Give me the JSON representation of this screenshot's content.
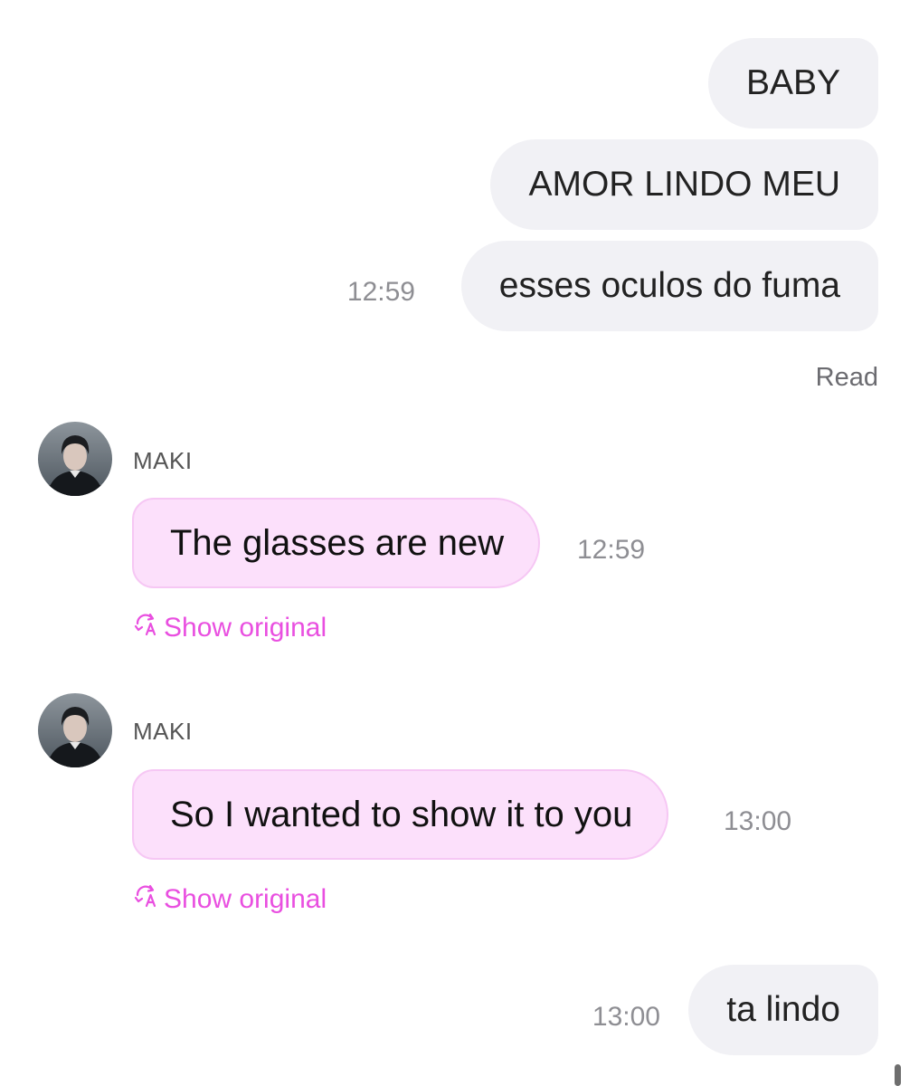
{
  "outgoing_group_1": {
    "messages": [
      {
        "text": "BABY"
      },
      {
        "text": "AMOR LINDO MEU"
      },
      {
        "text": "esses oculos do fuma"
      }
    ],
    "time": "12:59",
    "status": "Read"
  },
  "incoming": [
    {
      "sender": "MAKI",
      "text": "The glasses are new",
      "time": "12:59",
      "translate_action": "Show original"
    },
    {
      "sender": "MAKI",
      "text": "So I wanted to show it to you",
      "time": "13:00",
      "translate_action": "Show original"
    }
  ],
  "outgoing_group_2": {
    "messages": [
      {
        "text": "ta lindo"
      }
    ],
    "time": "13:00"
  },
  "colors": {
    "incoming_bubble": "#fce0fb",
    "outgoing_bubble": "#f1f1f5",
    "accent": "#e94fe0"
  }
}
